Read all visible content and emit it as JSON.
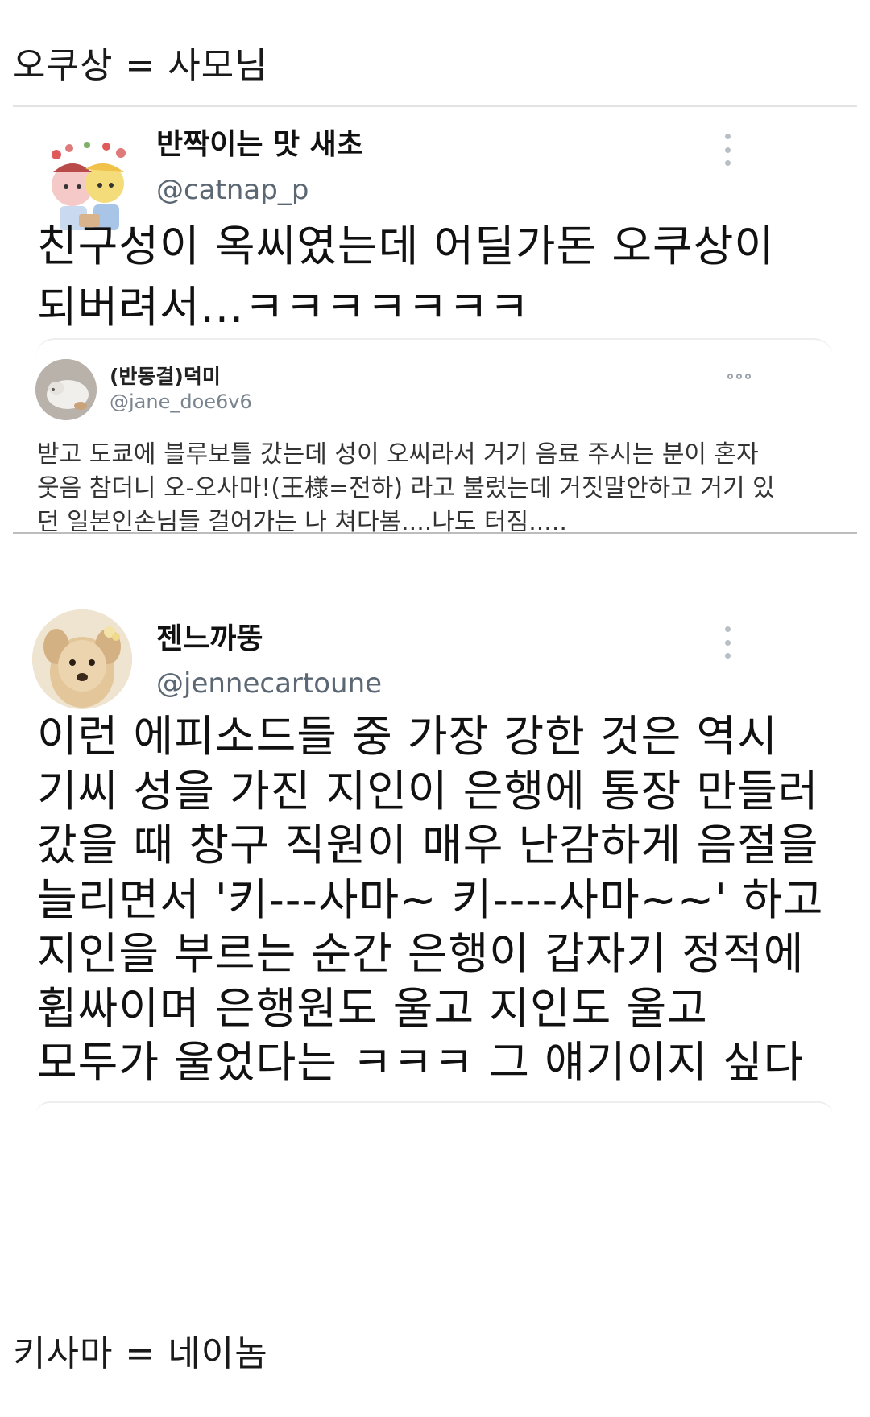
{
  "caption_top": "오쿠상 = 사모님",
  "caption_bottom": "키사마 = 네이놈",
  "tweet1": {
    "name": "반짝이는 맛 새초",
    "handle": "@catnap_p",
    "text": "친구성이 옥씨였는데 어딜가돈 오쿠상이\n되버려서...ㅋㅋㅋㅋㅋㅋㅋ",
    "quote": {
      "name": "(반동결)덕미",
      "handle": "@jane_doe6v6",
      "text": "받고 도쿄에 블루보틀 갔는데 성이 오씨라서 거기 음료 주시는 분이 혼자\n웃음 참더니 오-오사마!(王様=전하) 라고 불렀는데 거짓말안하고 거기 있\n던 일본인손님들 걸어가는 나 쳐다봄....나도 터짐....."
    }
  },
  "tweet2": {
    "name": "젠느까뚱",
    "handle": "@jennecartoune",
    "text": "이런 에피소드들 중 가장 강한 것은 역시\n기씨 성을 가진 지인이 은행에 통장 만들러\n갔을 때 창구 직원이 매우 난감하게 음절을\n늘리면서 '키---사마~ 키----사마~~' 하고\n지인을 부르는 순간 은행이 갑자기 정적에\n휩싸이며 은행원도 울고 지인도 울고\n모두가 울었다는 ㅋㅋㅋ 그 얘기이지 싶다"
  },
  "icons": {
    "more": "more-vertical-icon",
    "quote_more": "more-horizontal-icon"
  }
}
